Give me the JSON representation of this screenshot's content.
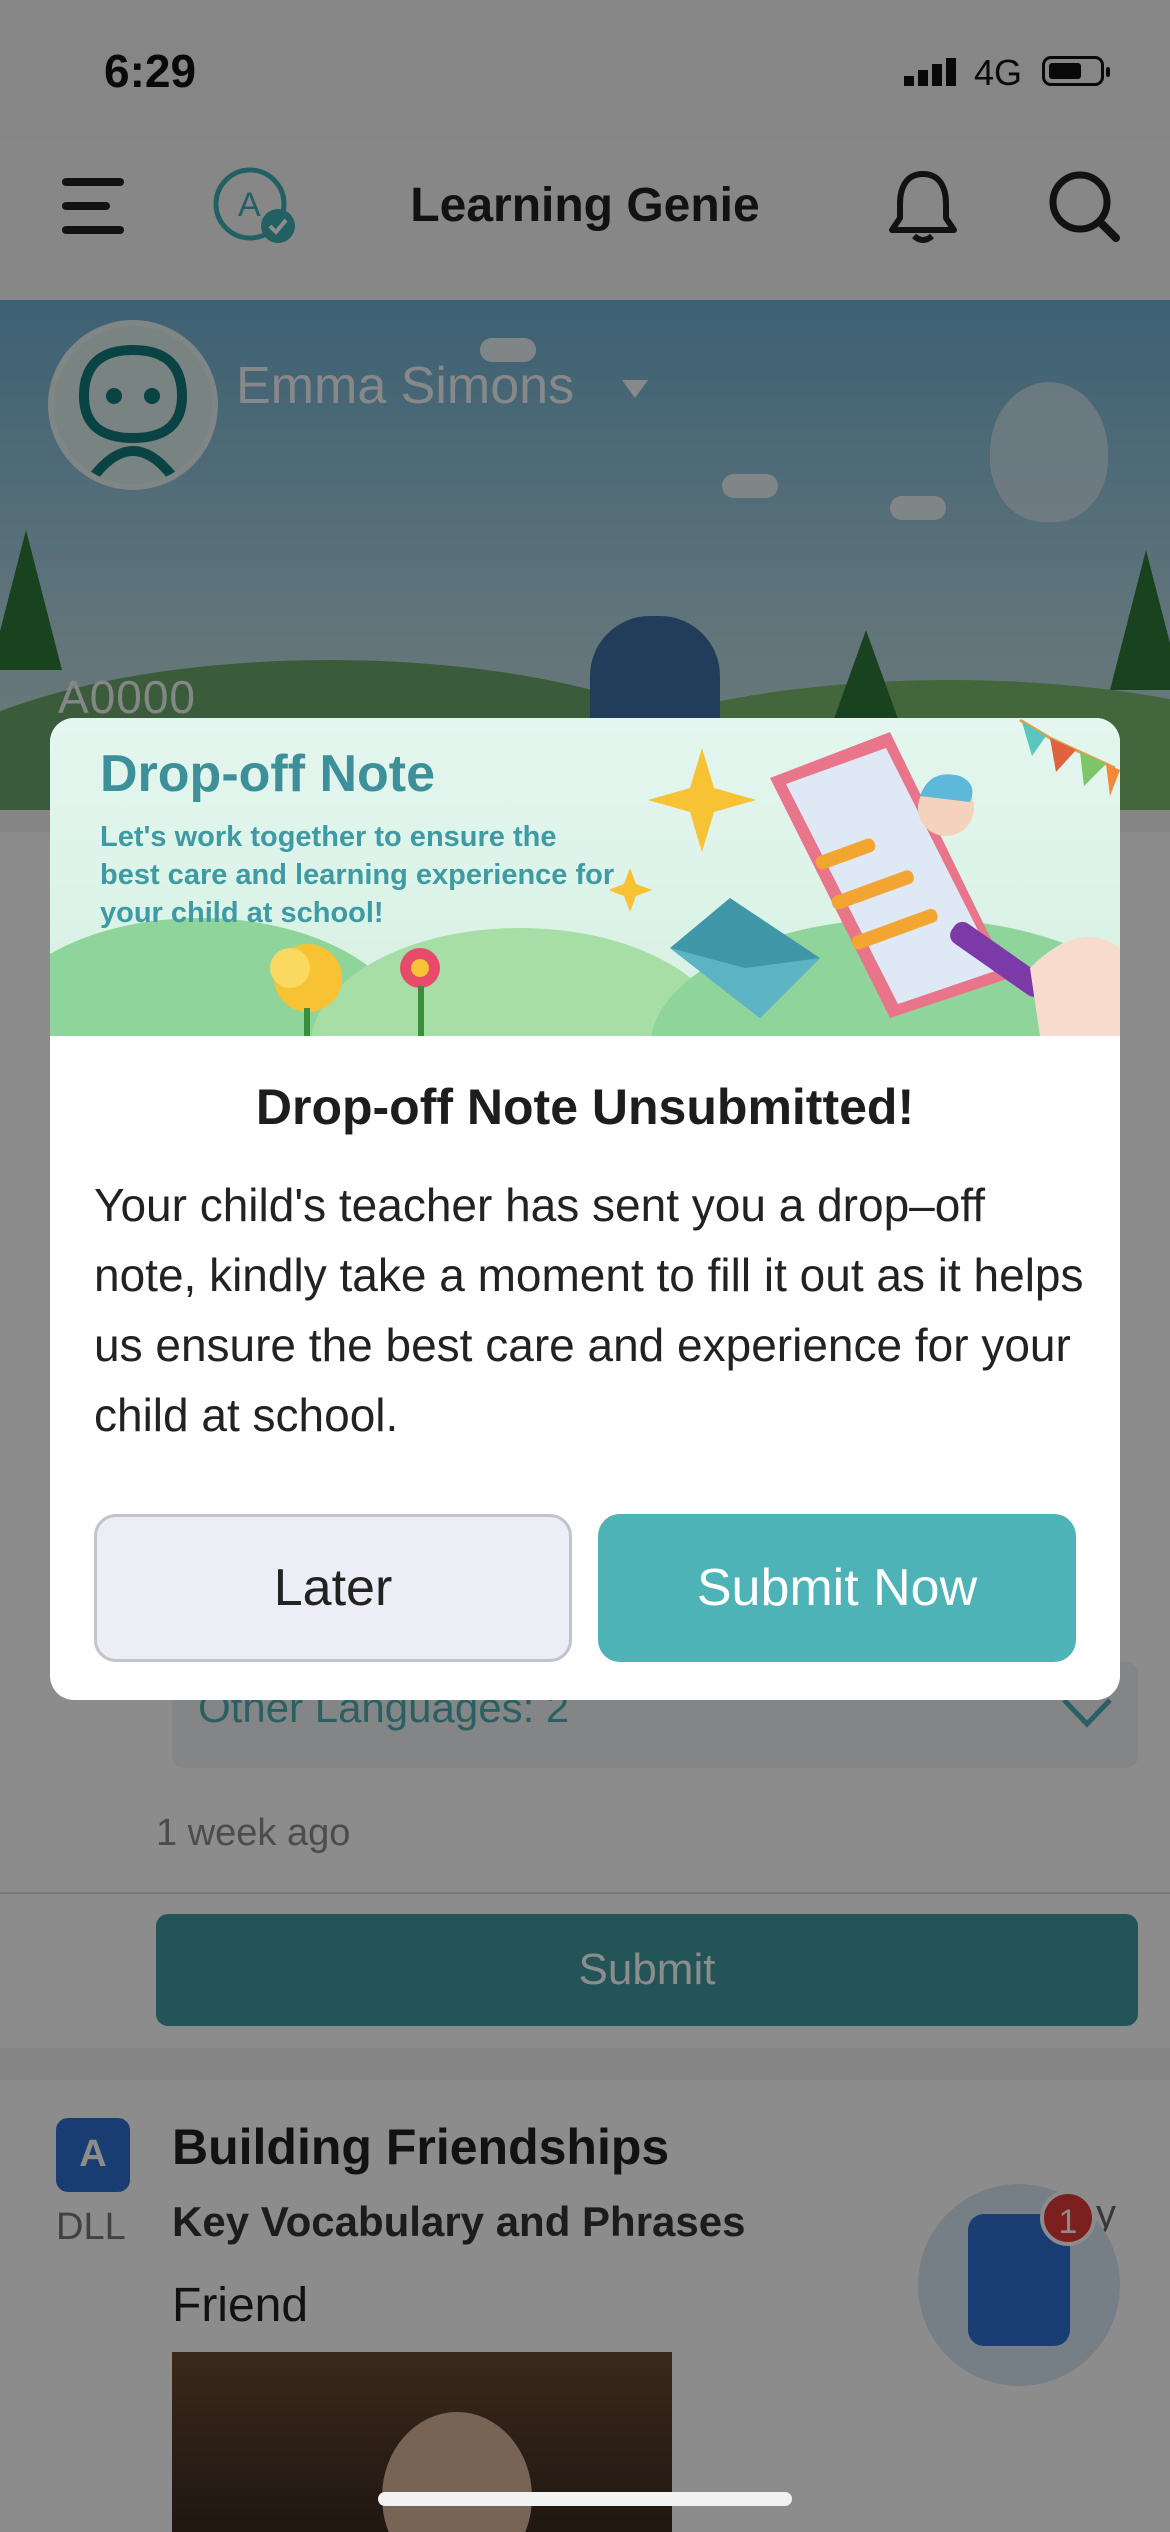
{
  "status_bar": {
    "time": "6:29",
    "network": "4G"
  },
  "nav": {
    "title": "Learning Genie"
  },
  "child": {
    "name": "Emma Simons",
    "id": "A0000"
  },
  "feed": {
    "languages_label": "Other Languages: 2",
    "time_ago": "1 week ago",
    "submit_label": "Submit"
  },
  "dll_card": {
    "badge_letter": "A",
    "badge_label": "DLL",
    "title": "Building Friendships",
    "subtitle": "Key Vocabulary and Phrases",
    "item": "Friend",
    "peek_text": "y"
  },
  "fab": {
    "badge_count": "1"
  },
  "modal": {
    "banner_title": "Drop-off Note",
    "banner_text": "Let's work together to ensure the best care and learning experience for your child at school!",
    "heading": "Drop-off Note Unsubmitted!",
    "body": "Your child's teacher has sent you a drop–off note, kindly take a moment to fill it out as it helps us ensure the best care and experience for your child at school.",
    "later_label": "Later",
    "submit_label": "Submit Now"
  },
  "colors": {
    "accent": "#4eb3b6",
    "banner_text": "#3e9aa3",
    "badge": "#e23a3a"
  },
  "icons": [
    "signal-icon",
    "battery-icon",
    "menu-icon",
    "profile-check-icon",
    "bell-icon",
    "search-icon",
    "dropdown-icon",
    "chevron-down-icon",
    "note-fab-icon"
  ]
}
